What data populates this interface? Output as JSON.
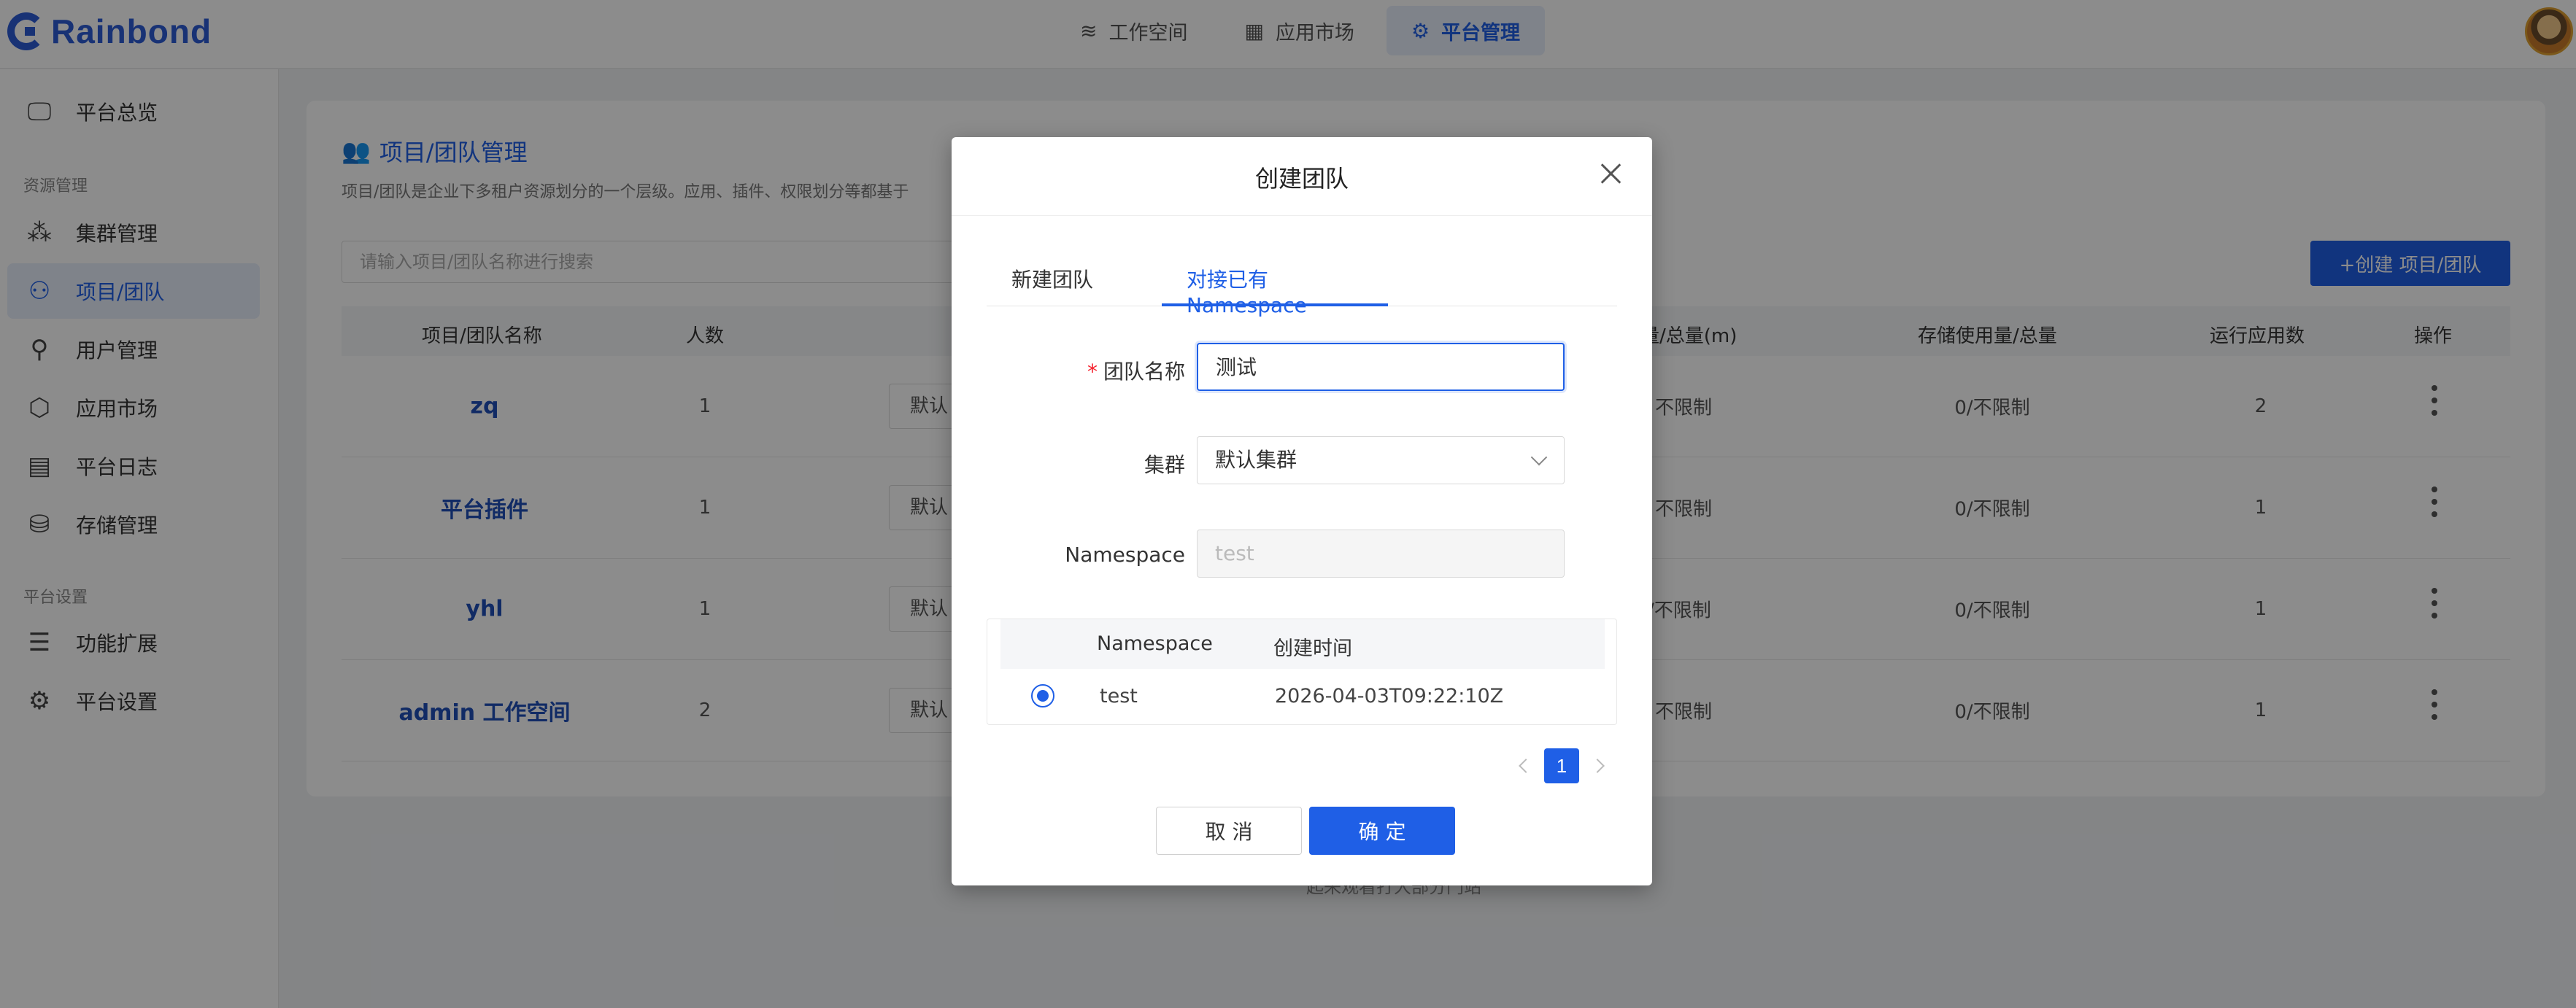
{
  "header": {
    "logo_text": "Rainbond",
    "nav": [
      {
        "label": "工作空间",
        "icon": "layers-icon"
      },
      {
        "label": "应用市场",
        "icon": "grid-icon"
      },
      {
        "label": "平台管理",
        "icon": "gear-icon",
        "active": true
      }
    ]
  },
  "sidebar": {
    "items": [
      {
        "label": "平台总览",
        "icon": "monitor-icon"
      },
      {
        "label": "集群管理",
        "icon": "cluster-icon"
      },
      {
        "label": "项目/团队",
        "icon": "team-icon",
        "active": true
      },
      {
        "label": "用户管理",
        "icon": "user-icon"
      },
      {
        "label": "应用市场",
        "icon": "cube-icon"
      },
      {
        "label": "平台日志",
        "icon": "log-icon"
      },
      {
        "label": "存储管理",
        "icon": "storage-icon"
      },
      {
        "label": "功能扩展",
        "icon": "extension-icon"
      },
      {
        "label": "平台设置",
        "icon": "settings-icon"
      }
    ],
    "groups": [
      "资源管理",
      "平台设置"
    ]
  },
  "page": {
    "title": "项目/团队管理",
    "description": "项目/团队是企业下多租户资源划分的一个层级。应用、插件、权限划分等都基于",
    "search_placeholder": "请输入项目/团队名称进行搜索",
    "create_button": "+创建 项目/团队",
    "footnote": "起来观看打大部分门站"
  },
  "table": {
    "headers": [
      "项目/团队名称",
      "人数",
      "量/总量(m)",
      "存储使用量/总量",
      "运行应用数",
      "操作"
    ],
    "rows": [
      {
        "name": "zq",
        "members": "1",
        "select": "默认",
        "cpu": "不限制",
        "storage": "0/不限制",
        "apps": "2"
      },
      {
        "name": "平台插件",
        "members": "1",
        "select": "默认",
        "cpu": "不限制",
        "storage": "0/不限制",
        "apps": "1"
      },
      {
        "name": "yhl",
        "members": "1",
        "select": "默认",
        "cpu": "/不限制",
        "storage": "0/不限制",
        "apps": "1"
      },
      {
        "name": "admin 工作空间",
        "members": "2",
        "select": "默认",
        "cpu": "不限制",
        "storage": "0/不限制",
        "apps": "1"
      }
    ]
  },
  "modal": {
    "title": "创建团队",
    "tabs": [
      "新建团队",
      "对接已有 Namespace"
    ],
    "active_tab": 1,
    "fields": {
      "team_name_label": "团队名称",
      "team_name_value": "测试",
      "cluster_label": "集群",
      "cluster_value": "默认集群",
      "namespace_label": "Namespace",
      "namespace_value": "test"
    },
    "ns_table": {
      "headers": [
        "Namespace",
        "创建时间"
      ],
      "rows": [
        {
          "namespace": "test",
          "created": "2026-04-03T09:22:10Z",
          "selected": true
        }
      ]
    },
    "pagination": {
      "current": "1"
    },
    "cancel_label": "取 消",
    "ok_label": "确 定"
  },
  "colors": {
    "accent": "#1f5fe6",
    "brand": "#2c5bd6"
  }
}
